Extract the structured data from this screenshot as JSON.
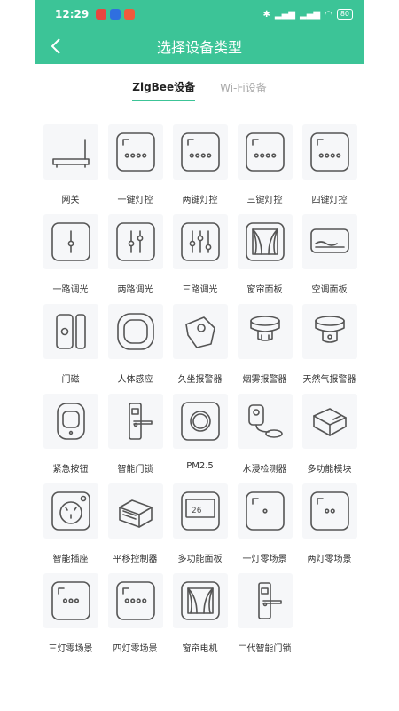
{
  "status": {
    "time": "12:29",
    "battery": "80"
  },
  "colors": {
    "accent": "#3cc497",
    "tile_bg": "#f6f7f9",
    "icon_stroke": "#555555"
  },
  "header": {
    "title": "选择设备类型",
    "back_icon": "chevron-left-icon"
  },
  "tabs": [
    {
      "label": "ZigBee设备",
      "active": true
    },
    {
      "label": "Wi-Fi设备",
      "active": false
    }
  ],
  "devices": [
    {
      "label": "网关",
      "icon": "gateway-icon"
    },
    {
      "label": "一键灯控",
      "icon": "switch-1-icon"
    },
    {
      "label": "两键灯控",
      "icon": "switch-2-icon"
    },
    {
      "label": "三键灯控",
      "icon": "switch-3-icon"
    },
    {
      "label": "四键灯控",
      "icon": "switch-4-icon"
    },
    {
      "label": "一路调光",
      "icon": "dimmer-1-icon"
    },
    {
      "label": "两路调光",
      "icon": "dimmer-2-icon"
    },
    {
      "label": "三路调光",
      "icon": "dimmer-3-icon"
    },
    {
      "label": "窗帘面板",
      "icon": "curtain-panel-icon"
    },
    {
      "label": "空调面板",
      "icon": "ac-panel-icon"
    },
    {
      "label": "门磁",
      "icon": "door-sensor-icon"
    },
    {
      "label": "人体感应",
      "icon": "motion-sensor-icon"
    },
    {
      "label": "久坐报警器",
      "icon": "sedentary-alarm-icon"
    },
    {
      "label": "烟雾报警器",
      "icon": "smoke-alarm-icon"
    },
    {
      "label": "天然气报警器",
      "icon": "gas-alarm-icon"
    },
    {
      "label": "紧急按钮",
      "icon": "emergency-button-icon"
    },
    {
      "label": "智能门锁",
      "icon": "smart-lock-icon"
    },
    {
      "label": "PM2.5",
      "icon": "pm25-sensor-icon"
    },
    {
      "label": "水浸检测器",
      "icon": "water-leak-icon"
    },
    {
      "label": "多功能模块",
      "icon": "multi-module-icon"
    },
    {
      "label": "智能插座",
      "icon": "smart-socket-icon"
    },
    {
      "label": "平移控制器",
      "icon": "translation-controller-icon"
    },
    {
      "label": "多功能面板",
      "icon": "multi-panel-icon",
      "display_value": "26"
    },
    {
      "label": "一灯零场景",
      "icon": "scene-1-icon"
    },
    {
      "label": "两灯零场景",
      "icon": "scene-2-icon"
    },
    {
      "label": "三灯零场景",
      "icon": "scene-3-icon"
    },
    {
      "label": "四灯零场景",
      "icon": "scene-4-icon"
    },
    {
      "label": "窗帘电机",
      "icon": "curtain-motor-icon"
    },
    {
      "label": "二代智能门锁",
      "icon": "smart-lock-gen2-icon"
    }
  ]
}
